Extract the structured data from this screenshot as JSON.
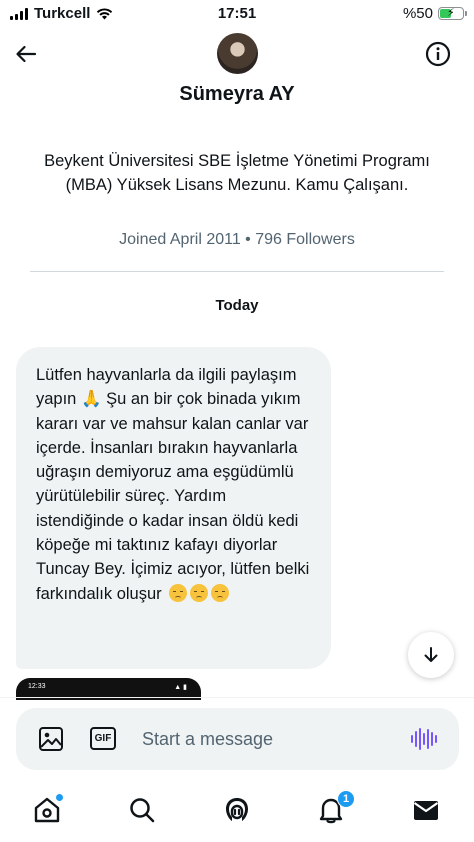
{
  "status_bar": {
    "carrier": "Turkcell",
    "time": "17:51",
    "battery_percent": "%50",
    "battery_level": 0.5
  },
  "profile": {
    "name": "Sümeyra AY",
    "bio": "Beykent Üniversitesi SBE İşletme Yönetimi Programı (MBA) Yüksek Lisans Mezunu. Kamu Çalışanı.",
    "meta": "Joined April 2011 • 796 Followers"
  },
  "conversation": {
    "day_label": "Today",
    "message_part1": "Lütfen hayvanlarla da ilgili paylaşım yapın ",
    "message_emoji_1": "🙏",
    "message_part2": " Şu an bir çok binada yıkım kararı var ve mahsur kalan canlar var içerde. İnsanları bırakın hayvanlarla uğraşın demiyoruz ama eşgüdümlü yürütülebilir süreç. Yardım istendiğinde o kadar insan öldü kedi köpeğe mi taktınız kafayı diyorlar Tuncay Bey. İçimiz acıyor, lütfen belki farkındalık oluşur ",
    "message_trailing_emoji": [
      "pensive-face",
      "pensive-face",
      "pensive-face"
    ],
    "media_preview_time": "12:33"
  },
  "composer": {
    "placeholder": "Start a message"
  },
  "bottom_nav": {
    "notifications_badge": "1",
    "accent_color": "#1d9bf0",
    "voice_color": "#7856ff"
  },
  "icons": [
    "back-arrow-icon",
    "info-icon",
    "image-icon",
    "gif-icon",
    "voice-icon",
    "home-icon",
    "search-icon",
    "spaces-icon",
    "bell-icon",
    "mail-icon",
    "chevron-down-icon"
  ]
}
